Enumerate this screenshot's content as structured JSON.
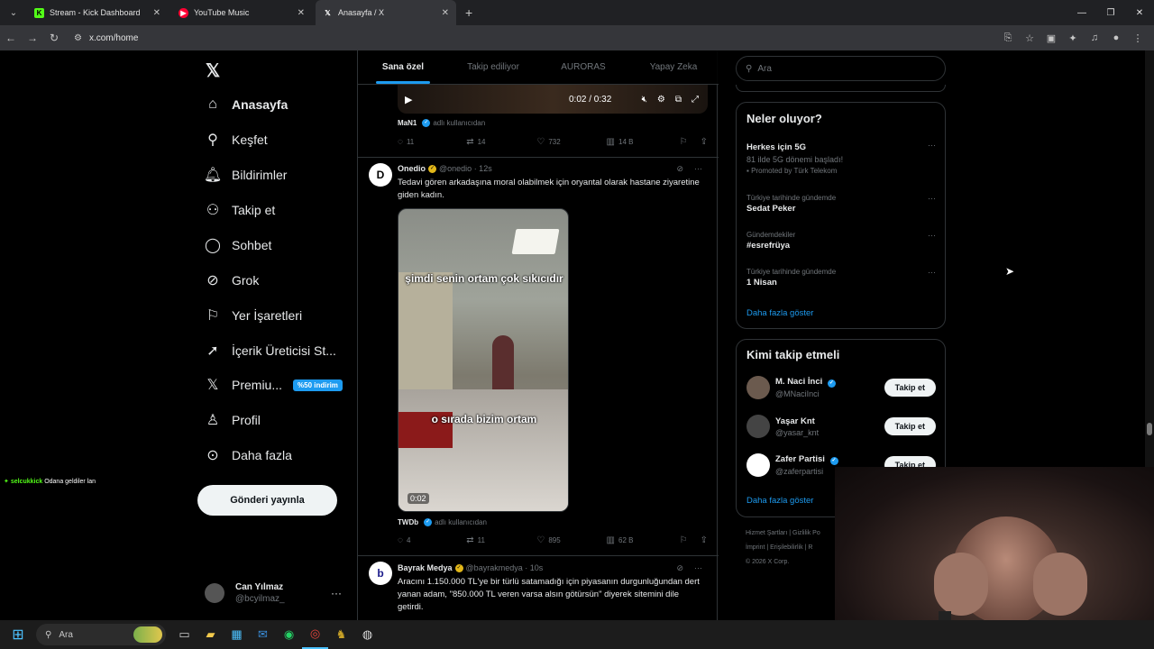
{
  "browser": {
    "tabs": [
      {
        "title": "Stream - Kick Dashboard",
        "fav": "K",
        "color": "#53fc18"
      },
      {
        "title": "YouTube Music",
        "fav": "▶",
        "color": "#ff0033"
      },
      {
        "title": "Anasayfa / X",
        "fav": "𝕏",
        "color": "#ffffff"
      }
    ],
    "url": "x.com/home"
  },
  "sidebar": {
    "items": [
      {
        "label": "Anasayfa",
        "icon": "home-icon"
      },
      {
        "label": "Keşfet",
        "icon": "search-icon"
      },
      {
        "label": "Bildirimler",
        "icon": "bell-icon"
      },
      {
        "label": "Takip et",
        "icon": "person-add-icon"
      },
      {
        "label": "Sohbet",
        "icon": "chat-icon"
      },
      {
        "label": "Grok",
        "icon": "grok-icon"
      },
      {
        "label": "Yer İşaretleri",
        "icon": "bookmark-icon"
      },
      {
        "label": "İçerik Üreticisi St...",
        "icon": "rocket-icon"
      },
      {
        "label": "Premiu...",
        "icon": "x-icon",
        "badge": "%50 indirim"
      },
      {
        "label": "Profil",
        "icon": "profile-icon"
      },
      {
        "label": "Daha fazla",
        "icon": "more-circle-icon"
      }
    ],
    "post_button": "Gönderi yayınla",
    "user": {
      "name": "Can Yılmaz",
      "handle": "@bcyilmaz_"
    }
  },
  "feed": {
    "tabs": [
      "Sana özel",
      "Takip ediliyor",
      "AURORAS",
      "Yapay Zeka"
    ],
    "post1": {
      "video_time": "0:02 / 0:32",
      "source_user": "MaN1",
      "source_suffix": "adlı kullanıcıdan",
      "replies": "11",
      "reposts": "14",
      "likes": "732",
      "views": "14 B"
    },
    "post2": {
      "name": "Onedio",
      "handle": "@onedio",
      "time": "· 12s",
      "text": "Tedavi gören arkadaşına moral olabilmek için oryantal olarak hastane ziyaretine giden kadın.",
      "caption_top": "şimdi senin ortam çok sıkıcıdır",
      "caption_bottom": "o sırada bizim ortam",
      "duration": "0:02",
      "source_user": "TWDb",
      "source_suffix": "adlı kullanıcıdan",
      "replies": "4",
      "reposts": "11",
      "likes": "895",
      "views": "62 B"
    },
    "post3": {
      "name": "Bayrak Medya",
      "handle": "@bayrakmedya",
      "time": "· 10s",
      "text": "Aracını 1.150.000 TL'ye bir türlü satamadığı için piyasanın durgunluğundan dert yanan adam, \"850.000 TL veren varsa alsın götürsün\" diyerek sitemini dile getirdi."
    }
  },
  "right": {
    "search_placeholder": "Ara",
    "trends_title": "Neler oluyor?",
    "trends": [
      {
        "category": "",
        "title": "Herkes için 5G",
        "sub": "81 ilde 5G dönemi başladı!",
        "promo": "Promoted by Türk Telekom"
      },
      {
        "category": "Türkiye tarihinde gündemde",
        "title": "Sedat Peker"
      },
      {
        "category": "Gündemdekiler",
        "title": "#esrefrüya"
      },
      {
        "category": "Türkiye tarihinde gündemde",
        "title": "1 Nisan"
      }
    ],
    "show_more": "Daha fazla göster",
    "who_title": "Kimi takip etmeli",
    "who": [
      {
        "name": "M. Naci İnci",
        "handle": "@MNaciInci",
        "verified": true
      },
      {
        "name": "Yaşar Knt",
        "handle": "@yasar_knt",
        "verified": false
      },
      {
        "name": "Zafer Partisi",
        "handle": "@zaferpartisi",
        "verified": true
      }
    ],
    "follow_label": "Takip et",
    "footer1": "Hizmet Şartları  |  Gizlilik Po",
    "footer2": "İmprint  |  Erişilebilirlik  |  R",
    "footer3": "© 2026 X Corp."
  },
  "overlay": {
    "chat_user": "selcukkick",
    "chat_msg": "Odana geldiler lan"
  },
  "taskbar": {
    "search": "Ara"
  }
}
